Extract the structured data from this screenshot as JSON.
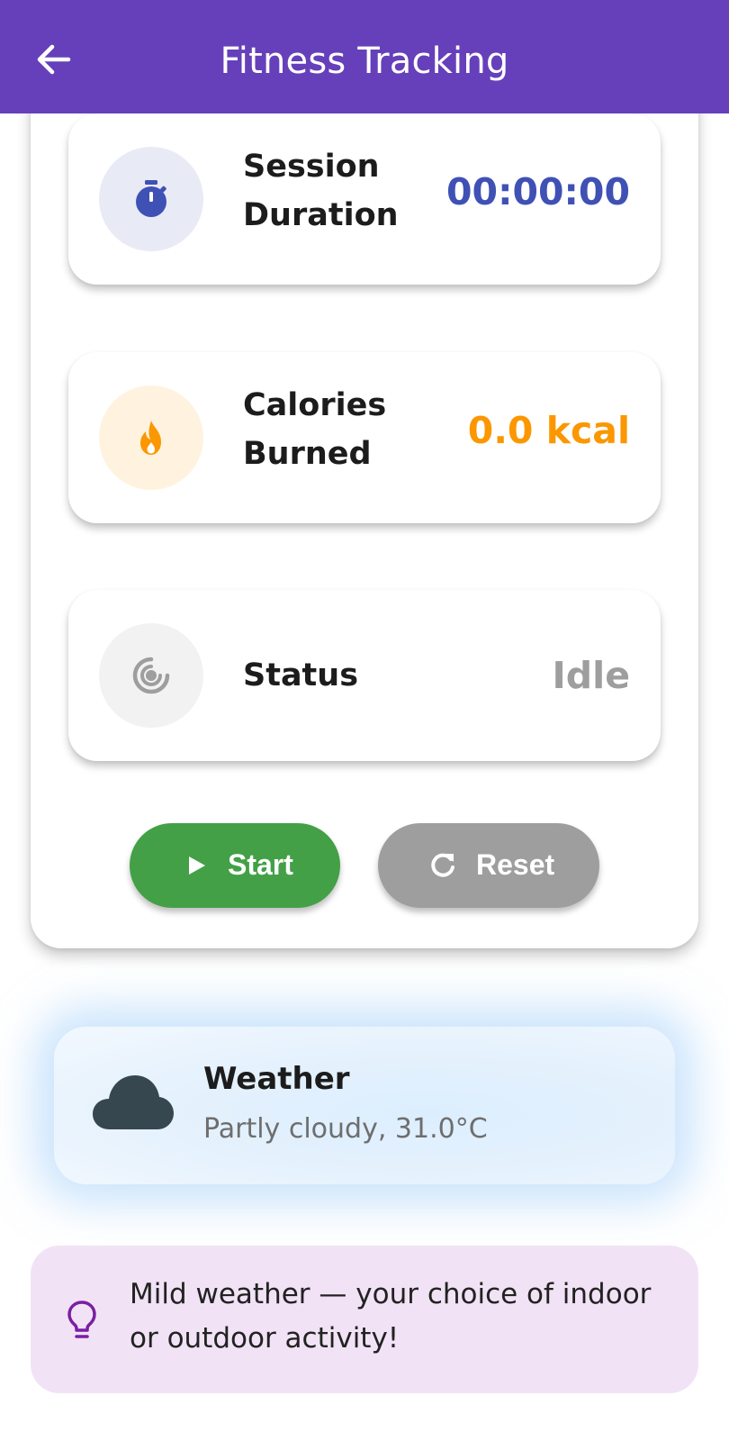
{
  "appbar": {
    "title": "Fitness Tracking",
    "back_icon": "arrow-back-icon",
    "color": "#6640BA"
  },
  "tracker": {
    "duration": {
      "label": "Session Duration",
      "value": "00:00:00",
      "icon": "timer-icon",
      "accent": "#3F51B5"
    },
    "calories": {
      "label": "Calories Burned",
      "value": "0.0 kcal",
      "icon": "fire-icon",
      "accent": "#FB9700"
    },
    "status": {
      "label": "Status",
      "value": "Idle",
      "icon": "radar-icon",
      "accent": "#9E9E9E"
    },
    "start_button": {
      "label": "Start",
      "icon": "play-icon",
      "color": "#43A047"
    },
    "reset_button": {
      "label": "Reset",
      "icon": "refresh-icon",
      "color": "#9E9E9E"
    }
  },
  "weather": {
    "title": "Weather",
    "description": "Partly cloudy, 31.0°C",
    "icon": "cloud-icon"
  },
  "tip": {
    "text": "Mild weather — your choice of indoor or outdoor activity!",
    "icon": "lightbulb-icon",
    "background": "#F1E3F5"
  }
}
